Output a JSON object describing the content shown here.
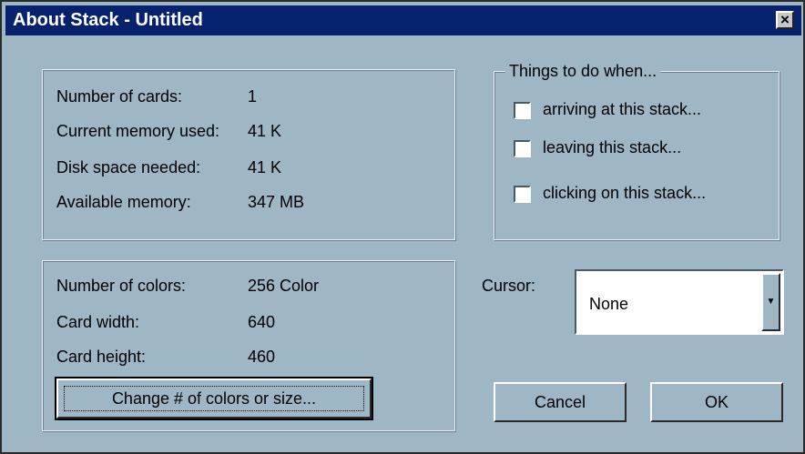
{
  "window": {
    "title": "About Stack - Untitled",
    "close_glyph": "×"
  },
  "stats": [
    {
      "label": "Number of cards:",
      "value": "1"
    },
    {
      "label": "Current memory used:",
      "value": "41 K"
    },
    {
      "label": "Disk space needed:",
      "value": "41 K"
    },
    {
      "label": "Available memory:",
      "value": "347 MB"
    }
  ],
  "display": [
    {
      "label": "Number of colors:",
      "value": "256 Color"
    },
    {
      "label": "Card width:",
      "value": "640"
    },
    {
      "label": "Card height:",
      "value": "460"
    }
  ],
  "change_button": {
    "label": "Change # of colors or size..."
  },
  "things": {
    "legend": "Things to do when...",
    "items": [
      {
        "label": "arriving at this stack...",
        "checked": false
      },
      {
        "label": "leaving this stack...",
        "checked": false
      },
      {
        "label": "clicking on this stack...",
        "checked": false
      }
    ]
  },
  "cursor": {
    "label": "Cursor:",
    "value": "None"
  },
  "buttons": {
    "cancel": "Cancel",
    "ok": "OK"
  }
}
